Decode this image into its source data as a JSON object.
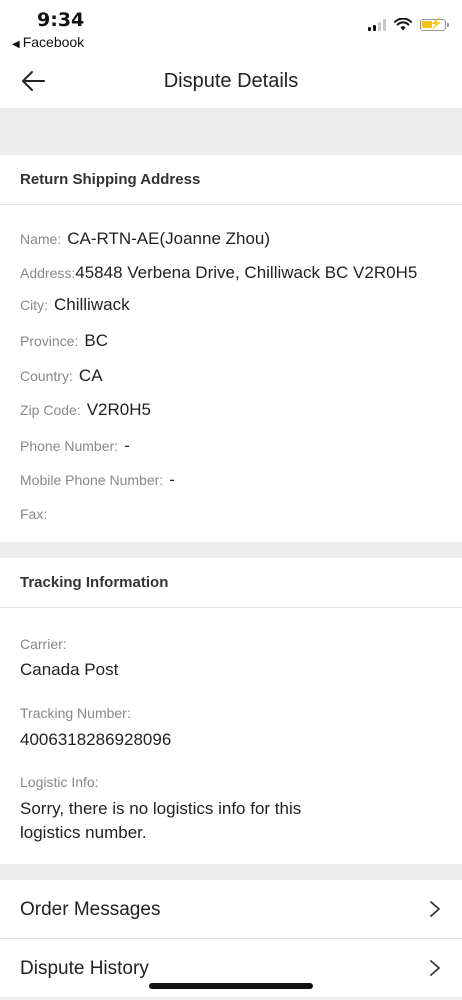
{
  "status_bar": {
    "time": "9:34",
    "back_app": "Facebook"
  },
  "header": {
    "title": "Dispute Details"
  },
  "return_address": {
    "heading": "Return Shipping Address",
    "name_label": "Name:",
    "name_value": "CA-RTN-AE(Joanne Zhou)",
    "address_label": "Address:",
    "address_value": "45848 Verbena Drive, Chilliwack BC V2R0H5",
    "city_label": "City:",
    "city_value": "Chilliwack",
    "province_label": "Province:",
    "province_value": "BC",
    "country_label": "Country:",
    "country_value": "CA",
    "zip_label": "Zip Code:",
    "zip_value": "V2R0H5",
    "phone_label": "Phone Number:",
    "phone_value": "-",
    "mobile_label": "Mobile Phone Number:",
    "mobile_value": "-",
    "fax_label": "Fax:",
    "fax_value": ""
  },
  "tracking": {
    "heading": "Tracking Information",
    "carrier_label": "Carrier:",
    "carrier_value": "Canada Post",
    "number_label": "Tracking Number:",
    "number_value": "4006318286928096",
    "logistic_label": "Logistic Info:",
    "logistic_value": "Sorry, there is no logistics info for this logistics number."
  },
  "links": {
    "order_messages": "Order Messages",
    "dispute_history": "Dispute History"
  },
  "colors": {
    "background": "#ececec",
    "battery_fill": "#f3c21b"
  }
}
